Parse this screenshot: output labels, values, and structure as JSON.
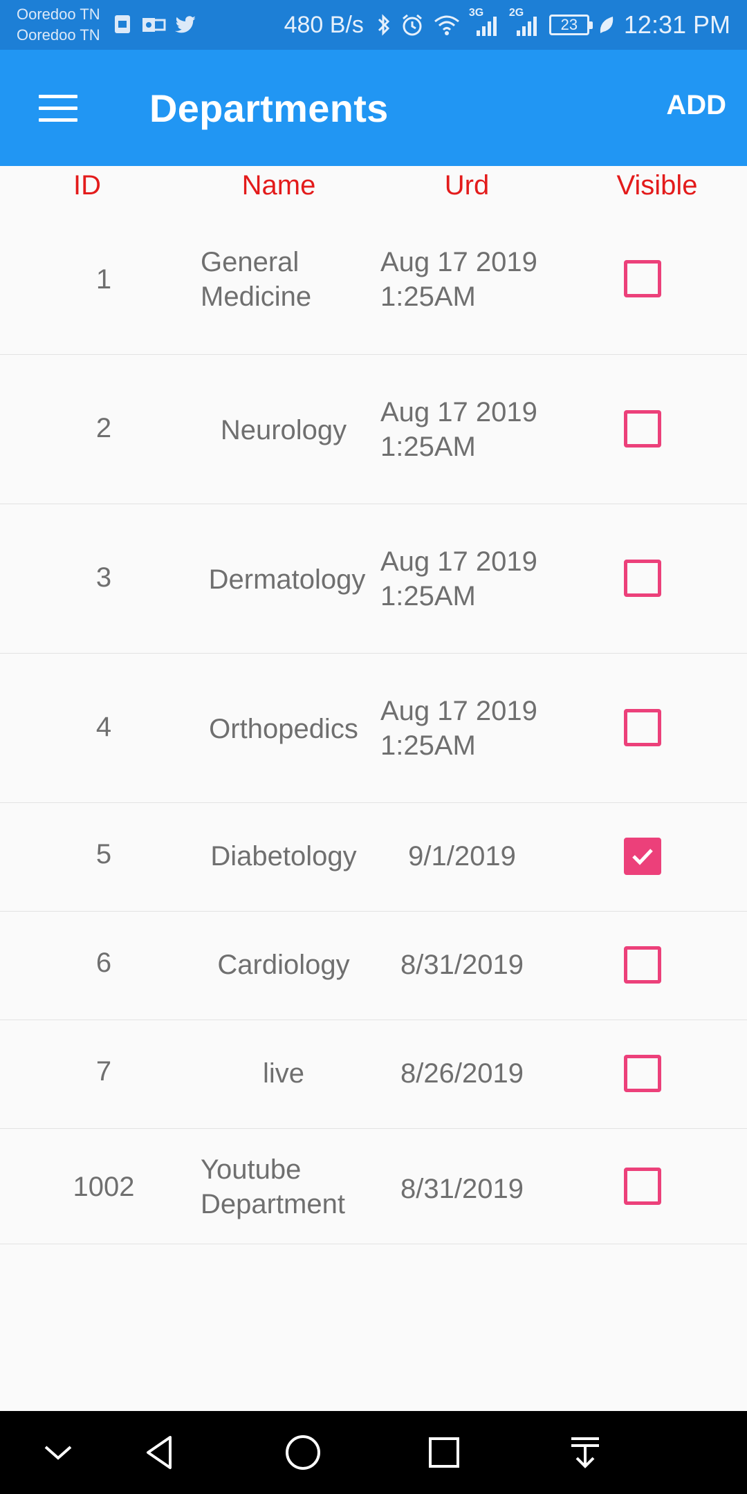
{
  "status_bar": {
    "carrier_1": "Ooredoo TN",
    "carrier_2": "Ooredoo TN",
    "net_speed": "480 B/s",
    "net_3g": "3G",
    "net_2g": "2G",
    "battery": "23",
    "time": "12:31 PM"
  },
  "app_bar": {
    "title": "Departments",
    "add_label": "ADD"
  },
  "table": {
    "headers": {
      "id": "ID",
      "name": "Name",
      "urd": "Urd",
      "visible": "Visible"
    },
    "rows": [
      {
        "id": "1",
        "name": "General Medicine",
        "urd": "Aug 17 2019 1:25AM",
        "visible": false
      },
      {
        "id": "2",
        "name": "Neurology",
        "urd": "Aug 17 2019 1:25AM",
        "visible": false
      },
      {
        "id": "3",
        "name": "Dermatology",
        "urd": "Aug 17 2019 1:25AM",
        "visible": false
      },
      {
        "id": "4",
        "name": "Orthopedics",
        "urd": "Aug 17 2019 1:25AM",
        "visible": false
      },
      {
        "id": "5",
        "name": "Diabetology",
        "urd": "9/1/2019",
        "visible": true
      },
      {
        "id": "6",
        "name": "Cardiology",
        "urd": "8/31/2019",
        "visible": false
      },
      {
        "id": "7",
        "name": "live",
        "urd": "8/26/2019",
        "visible": false
      },
      {
        "id": "1002",
        "name": "Youtube Department",
        "urd": "8/31/2019",
        "visible": false
      }
    ]
  },
  "colors": {
    "status_bar": "#1d7fd6",
    "app_bar": "#2196f3",
    "header_text": "#e31b1b",
    "checkbox": "#ec407a",
    "nav_bar": "#000000"
  },
  "icons": {
    "menu": "hamburger-menu-icon",
    "nav": [
      "chevron-down-icon",
      "back-icon",
      "home-icon",
      "recents-icon",
      "notification-pull-icon"
    ]
  }
}
